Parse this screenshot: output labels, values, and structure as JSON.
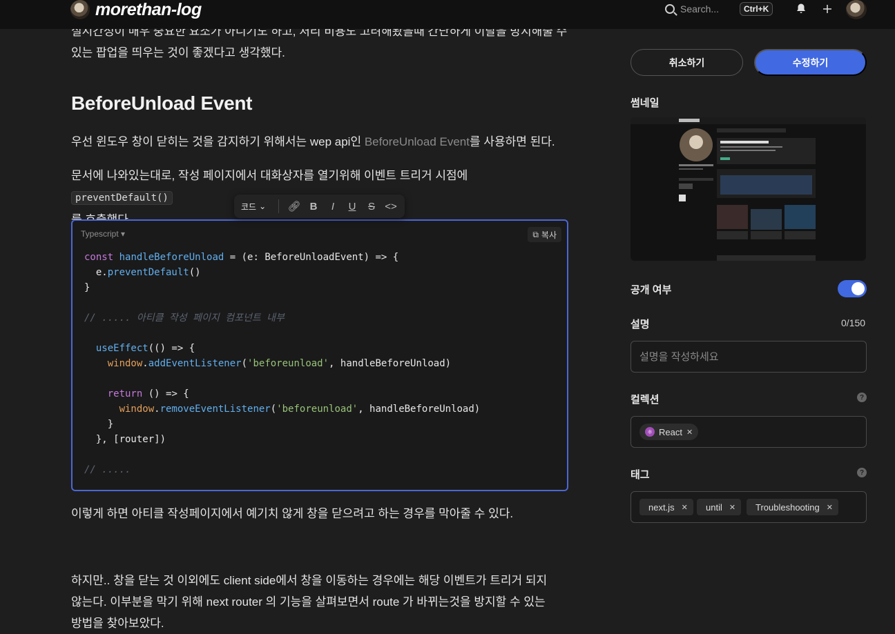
{
  "header": {
    "logo_text": "morethan-log",
    "search_placeholder": "Search...",
    "search_shortcut": "Ctrl+K"
  },
  "article": {
    "para_intro": "실시간성이 매우 중요한 요소가 아니기도 하고, 처리 비용도 고려해봤을때 간단하게 이탈을 방지해줄 수 있는 팝업을 띄우는 것이 좋겠다고 생각했다.",
    "para_intro_line1": "실시간성이 매우 중요한 요소가 아니기도 하고, 처리 비용도 고려해봤을때 간단하게 이탈을 방지해줄 수",
    "para_intro_line2": "있는 팝업을 띄우는 것이 좋겠다고 생각했다.",
    "heading": "BeforeUnload Event",
    "para_1_before": "우선 윈도우 창이 닫히는 것을 감지하기 위해서는 wep api인 ",
    "para_1_link": "BeforeUnload Event",
    "para_1_after": "를 사용하면 된다.",
    "para_2_before": "문서에 나와있는대로, 작성 페이지에서 대화상자를 열기위해 이벤트 트리거 시점에 ",
    "para_2_code": "preventDefault()",
    "para_2_after": "를 호출했다.",
    "para_3": "이렇게 하면 아티클 작성페이지에서 예기치 않게 창을 닫으려고 하는 경우를 막아줄 수 있다.",
    "para_4_line1": "하지만.. 창을 닫는 것 이외에도 client side에서 창을 이동하는 경우에는 해당 이벤트가 트리거 되지",
    "para_4_line2": "않는다. 이부분을 막기 위해 next router 의 기능을 살펴보면서 route 가 바뀌는것을 방지할 수 있는",
    "para_4_line3": "방법을 찾아보았다."
  },
  "format_toolbar": {
    "code_label": "코드"
  },
  "codeblock": {
    "language": "Typescript",
    "copy_label": "복사",
    "code_comment_1": "// ..... 아티클 작성 페이지 컴포넌트 내부",
    "code_comment_2": "// ....."
  },
  "sidebar": {
    "cancel_label": "취소하기",
    "save_label": "수정하기",
    "thumbnail_label": "썸네일",
    "public_label": "공개 여부",
    "public_enabled": true,
    "description_label": "설명",
    "description_counter": "0/150",
    "description_placeholder": "설명을 작성하세요",
    "collection_label": "컬렉션",
    "collection_chip": "React",
    "tags_label": "태그",
    "tags": [
      "next.js",
      "until",
      "Troubleshooting"
    ]
  },
  "colors": {
    "accent": "#4169e1",
    "background": "#1e1e1e",
    "header": "#111111"
  }
}
